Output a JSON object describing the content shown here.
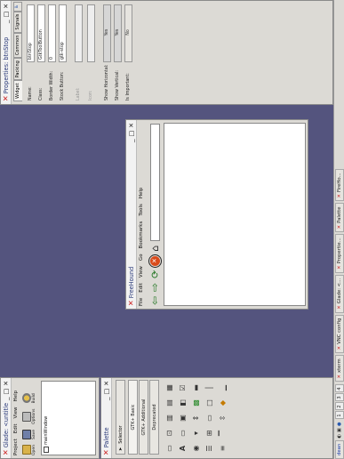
{
  "glade": {
    "title": "Glade: <untitled>",
    "menu": [
      "Project",
      "Edit",
      "View",
      "Help"
    ],
    "toolbar": [
      "Open",
      "Save",
      "Options",
      "Build"
    ],
    "widget": "mainWindow"
  },
  "palette": {
    "title": "Palette",
    "selector": "Selector",
    "tabs": [
      "GTK+ Basic",
      "GTK+ Additional",
      "Deprecated"
    ]
  },
  "freehound": {
    "title": "FreeHound",
    "menu": [
      "File",
      "Edit",
      "View",
      "Go",
      "Bookmarks",
      "Tools",
      "Help"
    ]
  },
  "properties": {
    "title": "Properties: btnStop",
    "tabs": [
      "Widget",
      "Packing",
      "Common",
      "Signals"
    ],
    "rows": [
      {
        "label": "Name:",
        "value": "btnStop"
      },
      {
        "label": "Class:",
        "value": "GtkToolButton"
      },
      {
        "label": "Border Width:",
        "value": "0"
      },
      {
        "label": "Stock Button:",
        "value": "gtk-stop"
      },
      {
        "label": "Label:",
        "value": ""
      },
      {
        "label": "Icon:",
        "value": ""
      },
      {
        "label": "Show Horizontal:",
        "value": "Yes"
      },
      {
        "label": "Show Vertical:",
        "value": "Yes"
      },
      {
        "label": "Is Important:",
        "value": "No"
      }
    ]
  },
  "taskbar": {
    "workspaces": [
      "1",
      "2",
      "3",
      "4"
    ],
    "items": [
      "xterm",
      "VNC config",
      "Glade: <...",
      "Propertie...",
      "Palette",
      "FireHo..."
    ],
    "user": "dean"
  },
  "colors": {
    "desktop": "#54547e",
    "window_bg": "#dcdad5",
    "title_text": "#2b3b7a",
    "x_logo": "#cc2222"
  }
}
